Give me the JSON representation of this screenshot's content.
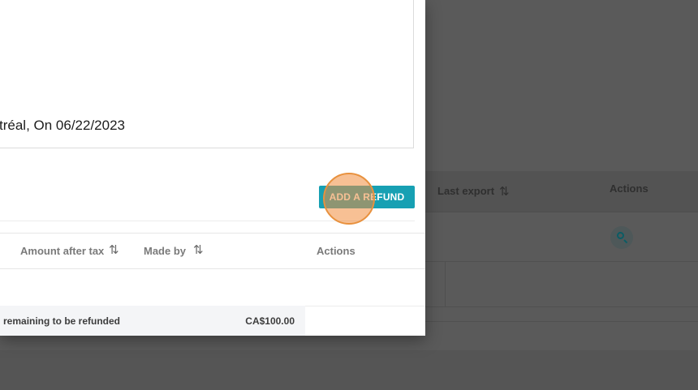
{
  "background": {
    "table": {
      "columns": [
        {
          "label": "Last export"
        },
        {
          "label": "Actions"
        }
      ],
      "row_action_icon": "zoom-in-icon"
    }
  },
  "modal": {
    "note_text": "tréal, On 06/22/2023",
    "add_refund_label": "ADD A REFUND",
    "refunds_table": {
      "columns": [
        {
          "label": "Amount after tax",
          "sortable": true
        },
        {
          "label": "Made by",
          "sortable": true
        },
        {
          "label": "Actions",
          "sortable": false
        }
      ],
      "sort_icon": "sort-arrows-icon"
    },
    "summary": {
      "label": "remaining to be refunded",
      "value": "CA$100.00"
    }
  },
  "colors": {
    "accent": "#17a0b3",
    "click_indicator": "#e8913e"
  }
}
